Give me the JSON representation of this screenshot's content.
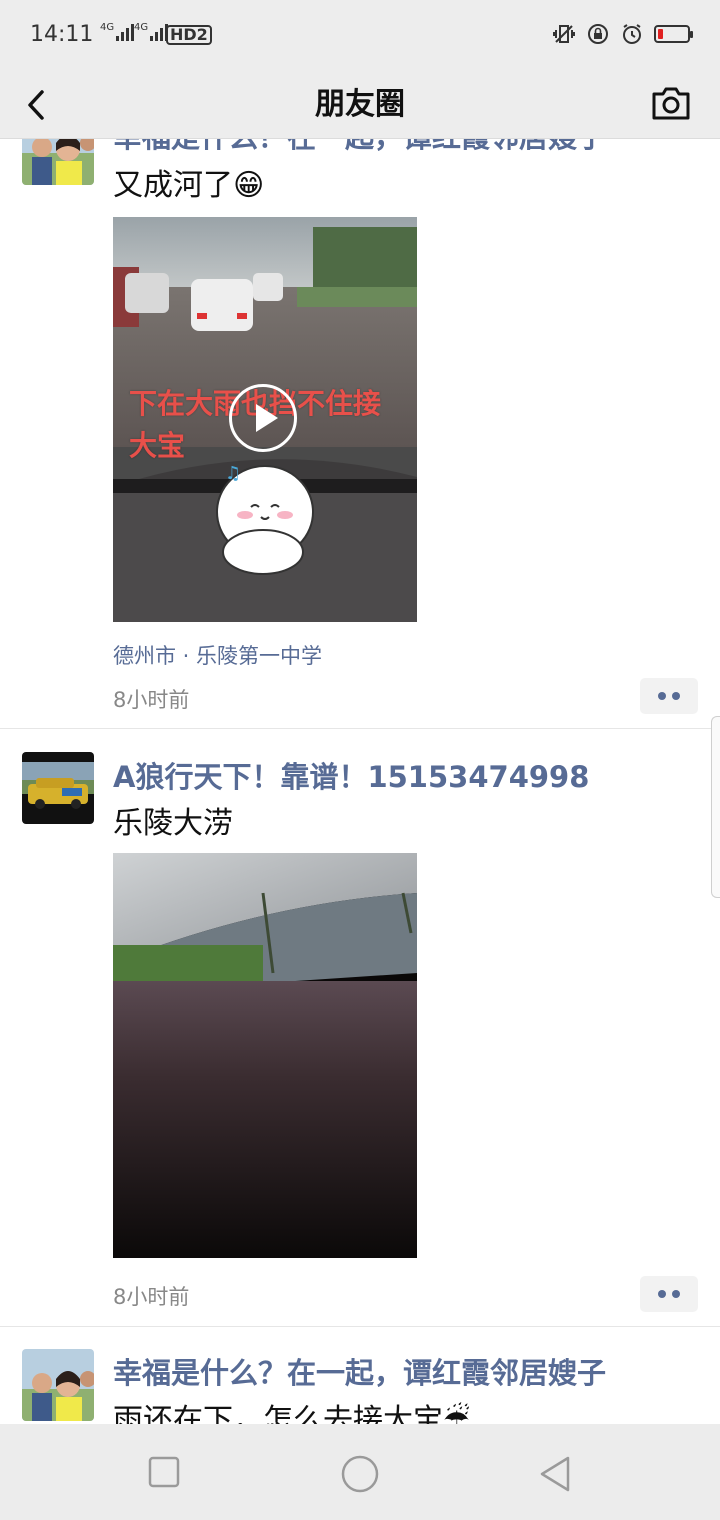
{
  "status_bar": {
    "time": "14:11",
    "net1": "4G",
    "net2": "4G",
    "hd": "HD2"
  },
  "nav": {
    "title": "朋友圈"
  },
  "posts": [
    {
      "nickname": "幸福是什么？在一起，谭红霞邻居嫂子",
      "text": "又成河了😁",
      "video_overlay_line1": "下在大雨也挡不住接",
      "video_overlay_line2": "大宝",
      "location": "德州市 · 乐陵第一中学",
      "time": "8小时前"
    },
    {
      "nickname": "A狼行天下！靠谱！15153474998",
      "text": "乐陵大涝",
      "time": "8小时前"
    },
    {
      "nickname": "幸福是什么？在一起，谭红霞邻居嫂子",
      "text": "雨还在下，怎么去接大宝☔"
    }
  ],
  "colors": {
    "nickname": "#576b95",
    "bar_bg": "#ededed",
    "battery_low": "#e02020"
  }
}
